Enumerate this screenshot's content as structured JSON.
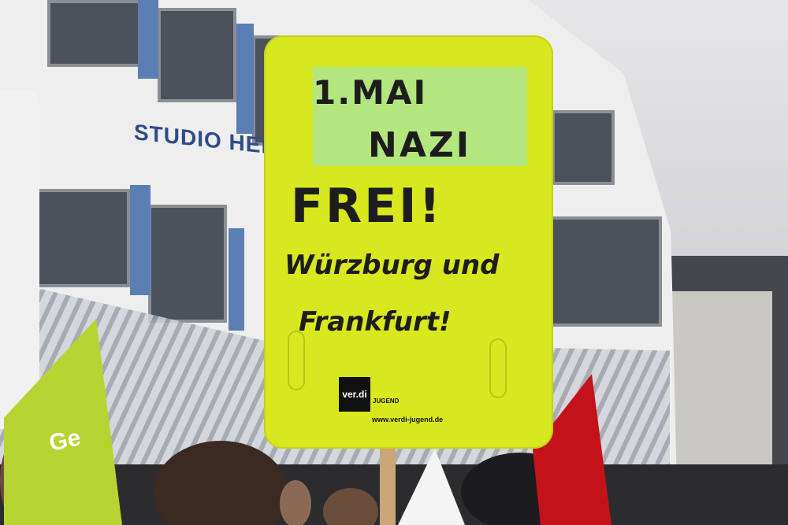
{
  "scene": {
    "description_elements": [
      "building",
      "protest placard",
      "flags",
      "crowd"
    ]
  },
  "building": {
    "sign_text": "STUDIO HEILBRONN"
  },
  "placard": {
    "lines": [
      "1.MAI",
      "NAZI",
      "FREI!",
      "Würzburg und",
      "Frankfurt!"
    ],
    "logo": "ver.di",
    "logo_sub": "JUGEND",
    "url": "www.verdi-jugend.de",
    "color": "#d8e81e"
  },
  "flags": {
    "green_text": "Ge",
    "green_color": "#b7d433",
    "red_color": "#c4121a"
  }
}
